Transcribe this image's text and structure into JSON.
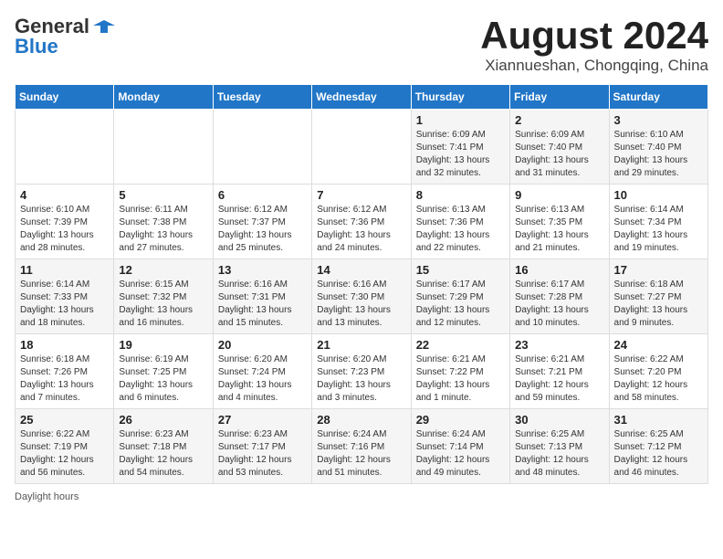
{
  "header": {
    "logo_general": "General",
    "logo_blue": "Blue",
    "main_title": "August 2024",
    "subtitle": "Xiannueshan, Chongqing, China"
  },
  "calendar": {
    "weekdays": [
      "Sunday",
      "Monday",
      "Tuesday",
      "Wednesday",
      "Thursday",
      "Friday",
      "Saturday"
    ],
    "weeks": [
      [
        {
          "day": "",
          "info": ""
        },
        {
          "day": "",
          "info": ""
        },
        {
          "day": "",
          "info": ""
        },
        {
          "day": "",
          "info": ""
        },
        {
          "day": "1",
          "info": "Sunrise: 6:09 AM\nSunset: 7:41 PM\nDaylight: 13 hours and 32 minutes."
        },
        {
          "day": "2",
          "info": "Sunrise: 6:09 AM\nSunset: 7:40 PM\nDaylight: 13 hours and 31 minutes."
        },
        {
          "day": "3",
          "info": "Sunrise: 6:10 AM\nSunset: 7:40 PM\nDaylight: 13 hours and 29 minutes."
        }
      ],
      [
        {
          "day": "4",
          "info": "Sunrise: 6:10 AM\nSunset: 7:39 PM\nDaylight: 13 hours and 28 minutes."
        },
        {
          "day": "5",
          "info": "Sunrise: 6:11 AM\nSunset: 7:38 PM\nDaylight: 13 hours and 27 minutes."
        },
        {
          "day": "6",
          "info": "Sunrise: 6:12 AM\nSunset: 7:37 PM\nDaylight: 13 hours and 25 minutes."
        },
        {
          "day": "7",
          "info": "Sunrise: 6:12 AM\nSunset: 7:36 PM\nDaylight: 13 hours and 24 minutes."
        },
        {
          "day": "8",
          "info": "Sunrise: 6:13 AM\nSunset: 7:36 PM\nDaylight: 13 hours and 22 minutes."
        },
        {
          "day": "9",
          "info": "Sunrise: 6:13 AM\nSunset: 7:35 PM\nDaylight: 13 hours and 21 minutes."
        },
        {
          "day": "10",
          "info": "Sunrise: 6:14 AM\nSunset: 7:34 PM\nDaylight: 13 hours and 19 minutes."
        }
      ],
      [
        {
          "day": "11",
          "info": "Sunrise: 6:14 AM\nSunset: 7:33 PM\nDaylight: 13 hours and 18 minutes."
        },
        {
          "day": "12",
          "info": "Sunrise: 6:15 AM\nSunset: 7:32 PM\nDaylight: 13 hours and 16 minutes."
        },
        {
          "day": "13",
          "info": "Sunrise: 6:16 AM\nSunset: 7:31 PM\nDaylight: 13 hours and 15 minutes."
        },
        {
          "day": "14",
          "info": "Sunrise: 6:16 AM\nSunset: 7:30 PM\nDaylight: 13 hours and 13 minutes."
        },
        {
          "day": "15",
          "info": "Sunrise: 6:17 AM\nSunset: 7:29 PM\nDaylight: 13 hours and 12 minutes."
        },
        {
          "day": "16",
          "info": "Sunrise: 6:17 AM\nSunset: 7:28 PM\nDaylight: 13 hours and 10 minutes."
        },
        {
          "day": "17",
          "info": "Sunrise: 6:18 AM\nSunset: 7:27 PM\nDaylight: 13 hours and 9 minutes."
        }
      ],
      [
        {
          "day": "18",
          "info": "Sunrise: 6:18 AM\nSunset: 7:26 PM\nDaylight: 13 hours and 7 minutes."
        },
        {
          "day": "19",
          "info": "Sunrise: 6:19 AM\nSunset: 7:25 PM\nDaylight: 13 hours and 6 minutes."
        },
        {
          "day": "20",
          "info": "Sunrise: 6:20 AM\nSunset: 7:24 PM\nDaylight: 13 hours and 4 minutes."
        },
        {
          "day": "21",
          "info": "Sunrise: 6:20 AM\nSunset: 7:23 PM\nDaylight: 13 hours and 3 minutes."
        },
        {
          "day": "22",
          "info": "Sunrise: 6:21 AM\nSunset: 7:22 PM\nDaylight: 13 hours and 1 minute."
        },
        {
          "day": "23",
          "info": "Sunrise: 6:21 AM\nSunset: 7:21 PM\nDaylight: 12 hours and 59 minutes."
        },
        {
          "day": "24",
          "info": "Sunrise: 6:22 AM\nSunset: 7:20 PM\nDaylight: 12 hours and 58 minutes."
        }
      ],
      [
        {
          "day": "25",
          "info": "Sunrise: 6:22 AM\nSunset: 7:19 PM\nDaylight: 12 hours and 56 minutes."
        },
        {
          "day": "26",
          "info": "Sunrise: 6:23 AM\nSunset: 7:18 PM\nDaylight: 12 hours and 54 minutes."
        },
        {
          "day": "27",
          "info": "Sunrise: 6:23 AM\nSunset: 7:17 PM\nDaylight: 12 hours and 53 minutes."
        },
        {
          "day": "28",
          "info": "Sunrise: 6:24 AM\nSunset: 7:16 PM\nDaylight: 12 hours and 51 minutes."
        },
        {
          "day": "29",
          "info": "Sunrise: 6:24 AM\nSunset: 7:14 PM\nDaylight: 12 hours and 49 minutes."
        },
        {
          "day": "30",
          "info": "Sunrise: 6:25 AM\nSunset: 7:13 PM\nDaylight: 12 hours and 48 minutes."
        },
        {
          "day": "31",
          "info": "Sunrise: 6:25 AM\nSunset: 7:12 PM\nDaylight: 12 hours and 46 minutes."
        }
      ]
    ]
  },
  "footer": {
    "note": "Daylight hours"
  }
}
